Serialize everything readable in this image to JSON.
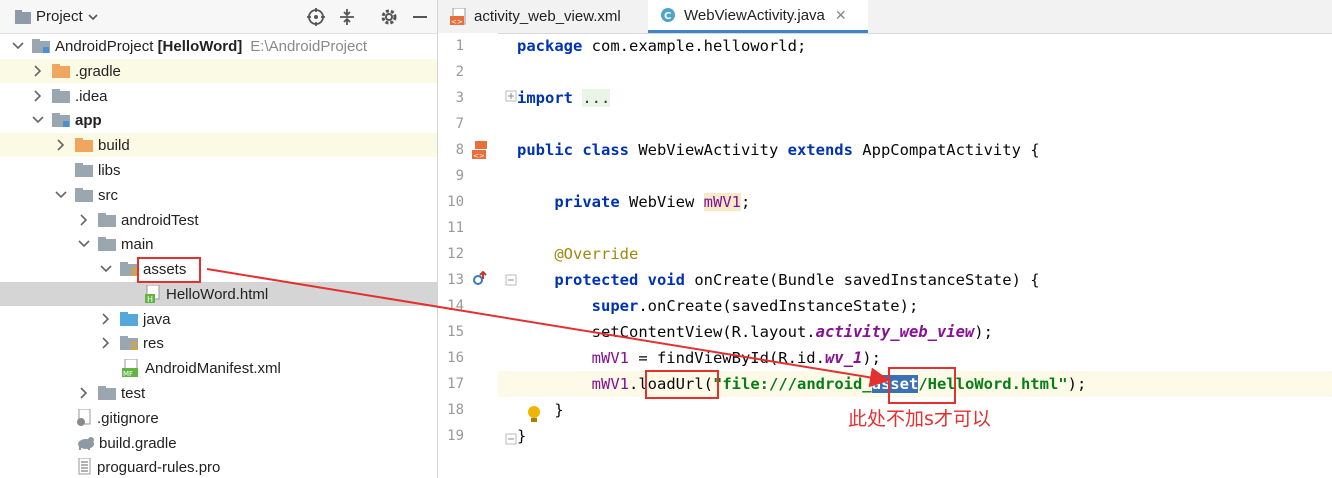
{
  "project_panel": {
    "title": "Project",
    "tree": [
      {
        "label": "AndroidProject",
        "bold_suffix": "[HelloWord]",
        "path": "E:\\AndroidProject"
      },
      {
        "label": ".gradle"
      },
      {
        "label": ".idea"
      },
      {
        "label": "app"
      },
      {
        "label": "build"
      },
      {
        "label": "libs"
      },
      {
        "label": "src"
      },
      {
        "label": "androidTest"
      },
      {
        "label": "main"
      },
      {
        "label": "assets"
      },
      {
        "label": "HelloWord.html"
      },
      {
        "label": "java"
      },
      {
        "label": "res"
      },
      {
        "label": "AndroidManifest.xml"
      },
      {
        "label": "test"
      },
      {
        "label": ".gitignore"
      },
      {
        "label": "build.gradle"
      },
      {
        "label": "proguard-rules.pro"
      }
    ]
  },
  "tabs": [
    {
      "label": "activity_web_view.xml"
    },
    {
      "label": "WebViewActivity.java"
    }
  ],
  "line_numbers": [
    "1",
    "2",
    "3",
    "7",
    "8",
    "9",
    "10",
    "11",
    "12",
    "13",
    "14",
    "15",
    "16",
    "17",
    "18",
    "19"
  ],
  "code": {
    "l1_kw": "package",
    "l1_rest": " com.example.helloworld;",
    "l3_kw": "import",
    "l3_fold": "...",
    "l8_a": "public class",
    "l8_b": " WebViewActivity ",
    "l8_c": "extends",
    "l8_d": " AppCompatActivity {",
    "l10_kw": "private",
    "l10_type": " WebView ",
    "l10_var": "mWV1",
    "l10_end": ";",
    "l12": "@Override",
    "l13_kw": "protected void",
    "l13_rest": " onCreate(Bundle savedInstanceState) {",
    "l14_kw": "super",
    "l14_rest": ".onCreate(savedInstanceState);",
    "l15_a": "setContentView(R.layout.",
    "l15_b": "activity_web_view",
    "l15_c": ");",
    "l16_a": "mWV1",
    "l16_b": " = findViewById(R.id.",
    "l16_c": "wv_1",
    "l16_d": ");",
    "l17_a": "mWV1",
    "l17_b": ".",
    "l17_c": "loadUrl",
    "l17_d": "(",
    "l17_e": "\"file:///android_",
    "l17_f": "asset",
    "l17_g": "/HelloWord.html\"",
    "l17_h": ");",
    "l18": "}",
    "l19": "}"
  },
  "annotation": {
    "note": "此处不加s才可以",
    "color": "#e53030"
  }
}
